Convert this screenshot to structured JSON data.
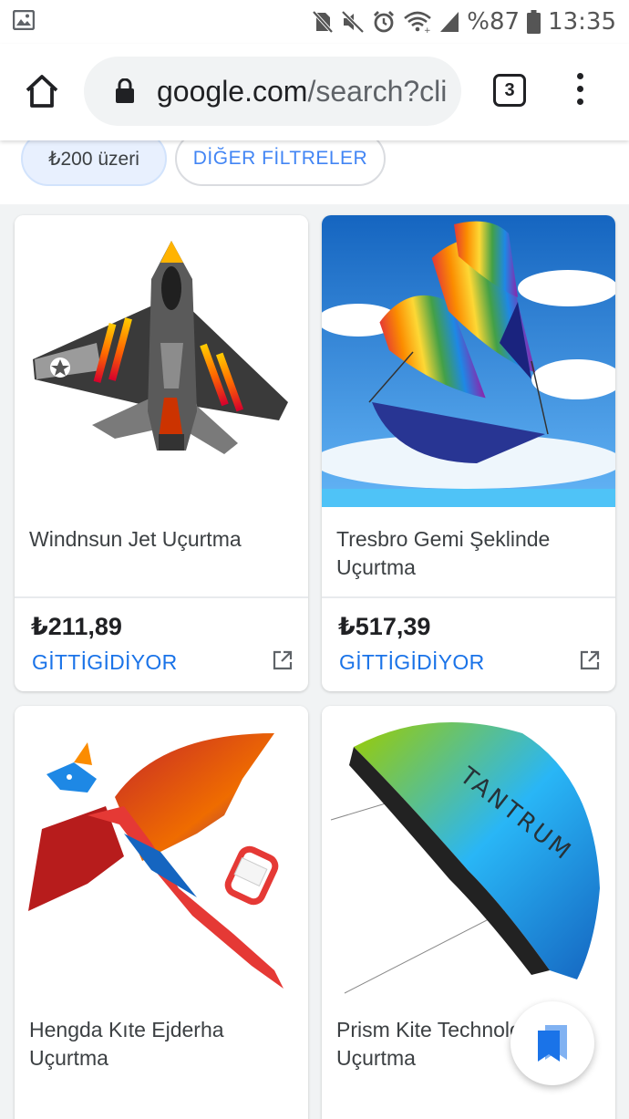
{
  "status_bar": {
    "battery": "%87",
    "time": "13:35",
    "icons": [
      "gallery-icon",
      "no-sim-icon",
      "mute-icon",
      "alarm-icon",
      "wifi-icon",
      "signal-icon",
      "battery-icon"
    ]
  },
  "toolbar": {
    "url_domain": "google.com",
    "url_path": "/search?cli",
    "tab_count": "3"
  },
  "filters": {
    "price_chip": "₺200 üzeri",
    "more_filters": "DİĞER FİLTRELER"
  },
  "products": [
    {
      "title": "Windnsun Jet Uçurtma",
      "price": "₺211,89",
      "store": "GİTTİGİDİYOR"
    },
    {
      "title": "Tresbro Gemi Şeklinde Uçurtma",
      "price": "₺517,39",
      "store": "GİTTİGİDİYOR"
    },
    {
      "title": "Hengda Kıte Ejderha Uçurtma"
    },
    {
      "title": "Prism Kite Technology Uçurtma"
    }
  ],
  "colors": {
    "accent": "#1a73e8",
    "chip_selected_bg": "#e8f0fe",
    "fab_icon": "#1a73e8"
  }
}
